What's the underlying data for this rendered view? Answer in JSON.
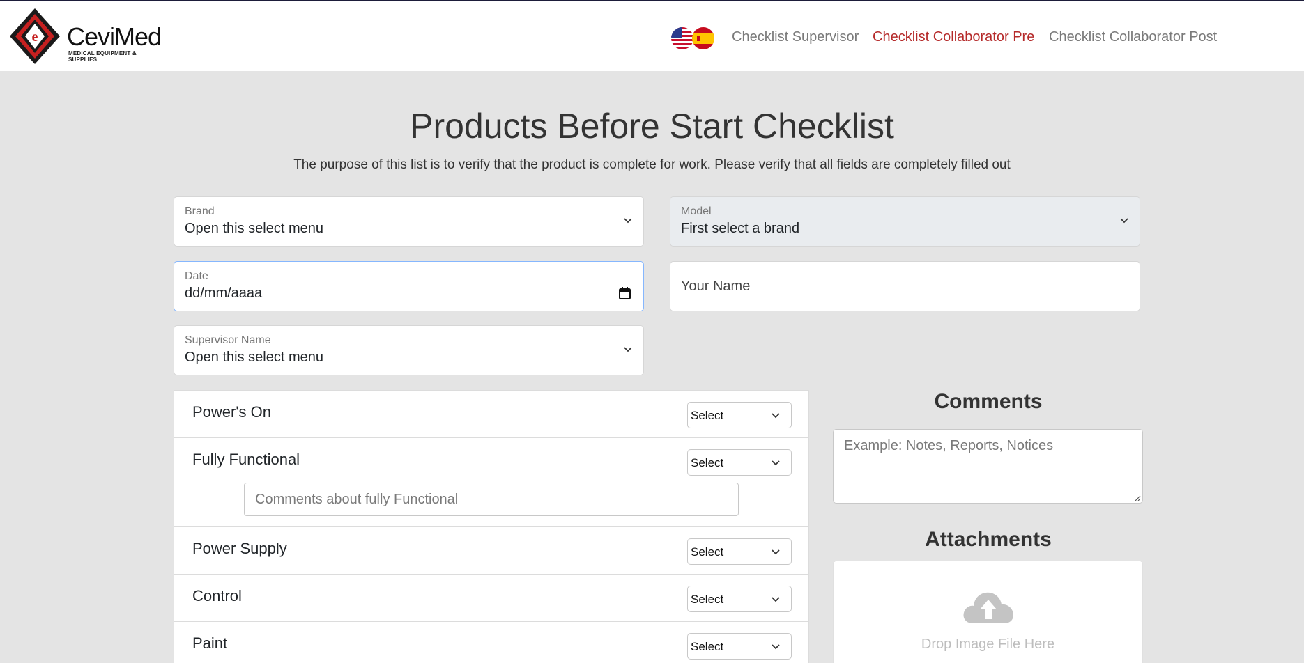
{
  "brand": {
    "name": "CeviMed",
    "tagline": "MEDICAL EQUIPMENT & SUPPLIES"
  },
  "nav": {
    "links": [
      "Checklist Supervisor",
      "Checklist Collaborator Pre",
      "Checklist Collaborator Post"
    ],
    "active": "Checklist Collaborator Pre",
    "active_color": "#b52a2a"
  },
  "page": {
    "title": "Products Before Start Checklist",
    "subtitle": "The purpose of this list is to verify that the product is complete for work. Please verify that all fields are completely filled out"
  },
  "form": {
    "brand_label": "Brand",
    "brand_value": "Open this select menu",
    "model_label": "Model",
    "model_value": "First select a brand",
    "date_label": "Date",
    "date_value": "dd/mm/aaaa",
    "your_name_placeholder": "Your Name",
    "supervisor_label": "Supervisor Name",
    "supervisor_value": "Open this select menu"
  },
  "checklist": {
    "select_label": "Select",
    "items": [
      "Power's On",
      "Fully Functional",
      "Power Supply",
      "Control",
      "Paint"
    ],
    "fully_functional_comment_placeholder": "Comments about fully Functional"
  },
  "comments": {
    "heading": "Comments",
    "placeholder": "Example: Notes, Reports, Notices"
  },
  "attachments": {
    "heading": "Attachments",
    "drop_text": "Drop Image File Here"
  },
  "icons": [
    "logo-icon",
    "us-flag-icon",
    "spain-flag-icon",
    "chevron-down-icon",
    "calendar-icon",
    "cloud-upload-icon",
    "resize-grip-icon"
  ]
}
